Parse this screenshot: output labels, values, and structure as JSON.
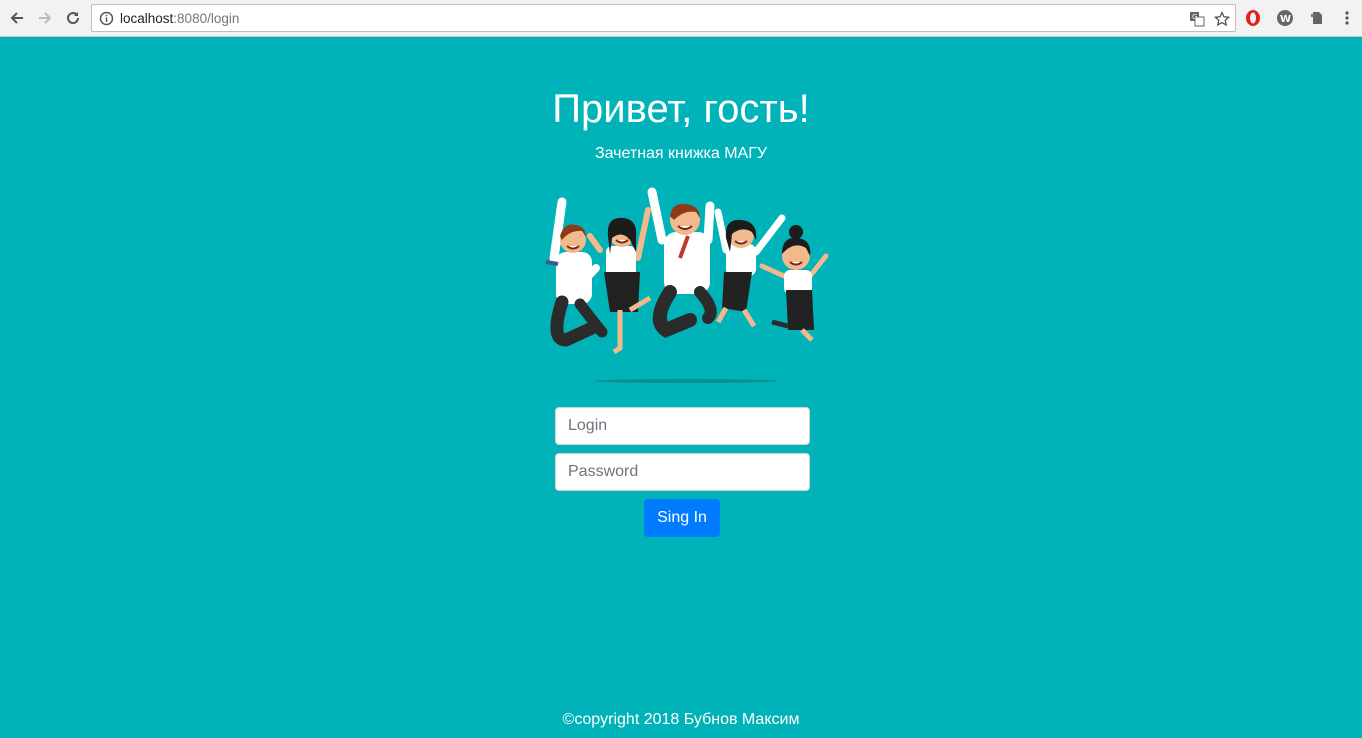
{
  "browser": {
    "url_host": "localhost",
    "url_rest": ":8080/login"
  },
  "page": {
    "title": "Привет, гость!",
    "subtitle": "Зачетная книжка МАГУ",
    "hero_image_icon": "jumping-people-illustration"
  },
  "form": {
    "login_placeholder": "Login",
    "login_value": "",
    "password_placeholder": "Password",
    "password_value": "",
    "submit_label": "Sing In"
  },
  "footer": {
    "copyright": "©copyright 2018 Бубнов Максим"
  },
  "colors": {
    "background": "#00b3b8",
    "button": "#007bff"
  }
}
